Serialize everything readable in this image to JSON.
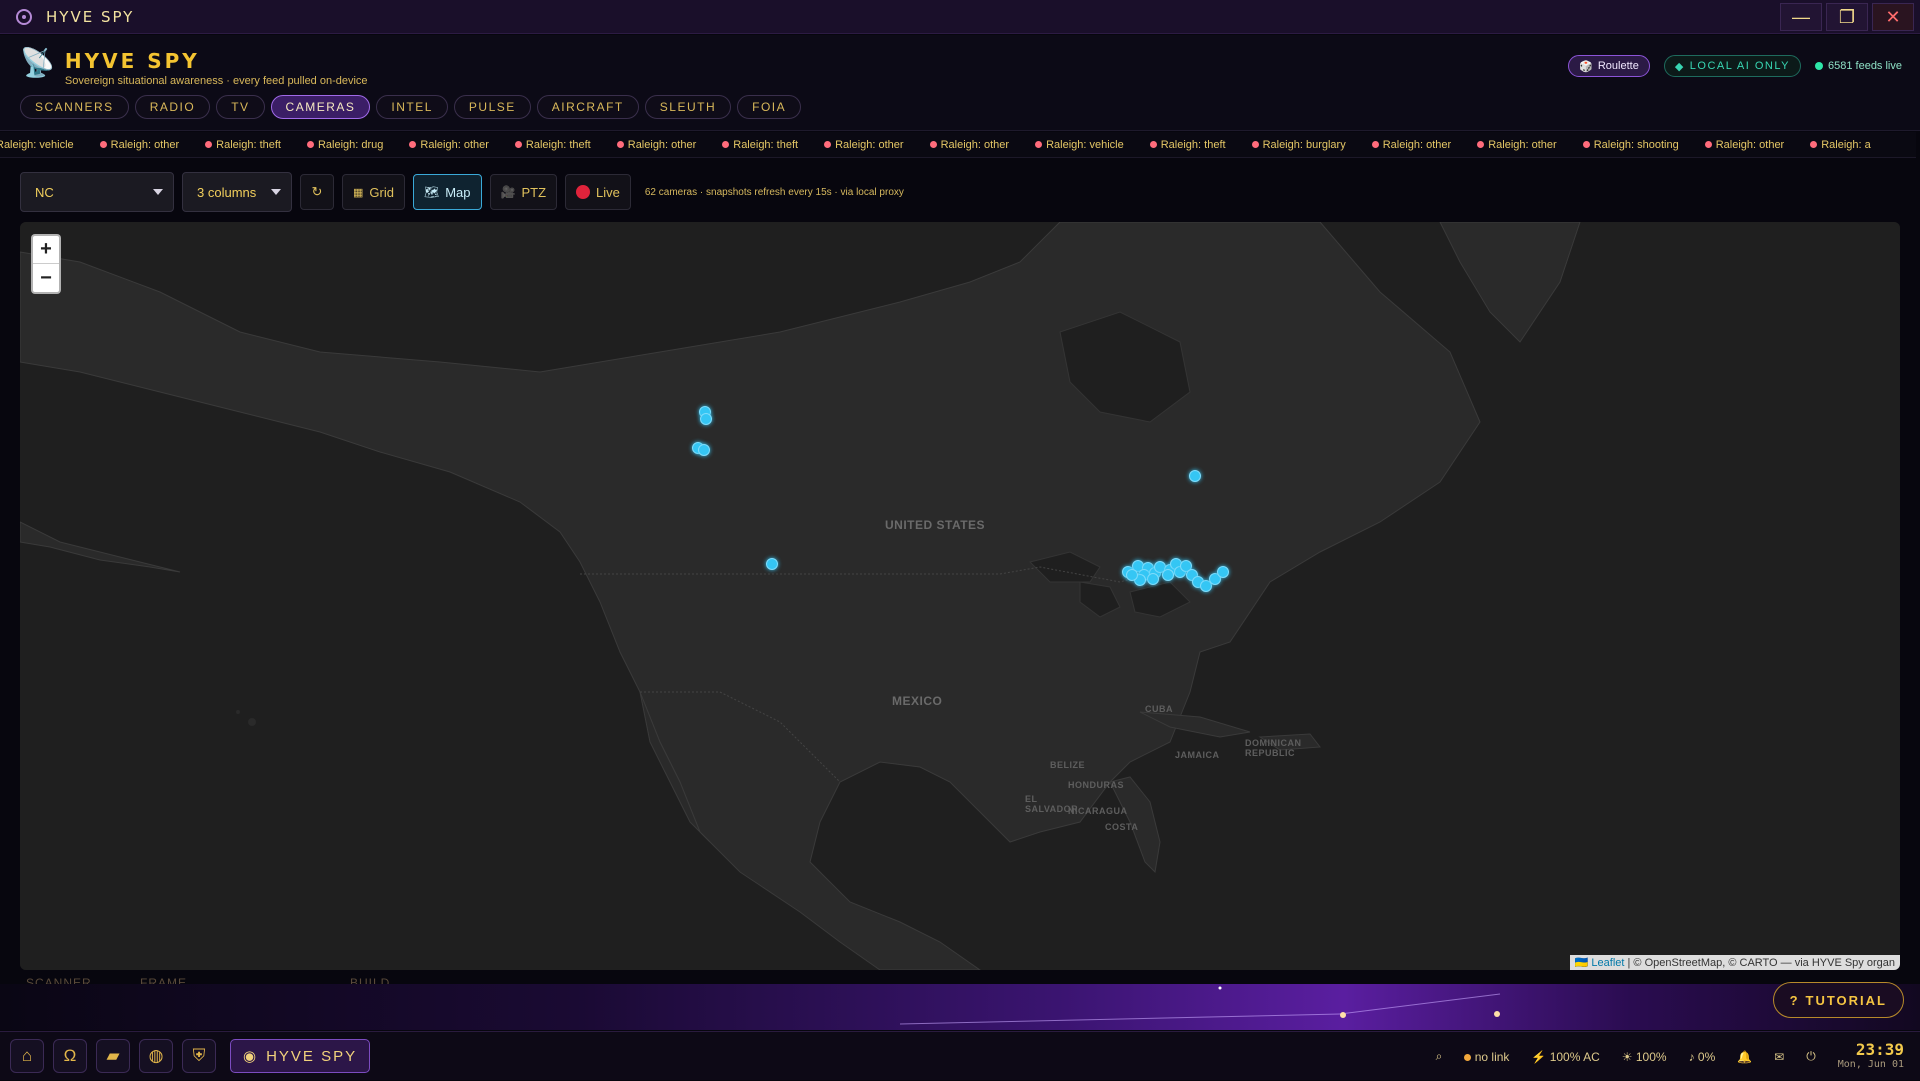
{
  "window": {
    "title": "HYVE SPY",
    "minimize": "—",
    "maximize": "❐",
    "close": "✕"
  },
  "app": {
    "name": "HYVE SPY",
    "tagline": "Sovereign situational awareness · every feed pulled on-device",
    "roulette": "Roulette",
    "local_ai": "LOCAL AI ONLY",
    "feeds_live": "6581 feeds live"
  },
  "tabs": [
    {
      "label": "SCANNERS"
    },
    {
      "label": "RADIO"
    },
    {
      "label": "TV"
    },
    {
      "label": "CAMERAS",
      "active": true
    },
    {
      "label": "INTEL"
    },
    {
      "label": "PULSE"
    },
    {
      "label": "AIRCRAFT"
    },
    {
      "label": "SLEUTH"
    },
    {
      "label": "FOIA"
    }
  ],
  "ticker": [
    "Raleigh: vehicle",
    "Raleigh: other",
    "Raleigh: theft",
    "Raleigh: drug",
    "Raleigh: other",
    "Raleigh: theft",
    "Raleigh: other",
    "Raleigh: theft",
    "Raleigh: other",
    "Raleigh: other",
    "Raleigh: vehicle",
    "Raleigh: theft",
    "Raleigh: burglary",
    "Raleigh: other",
    "Raleigh: other",
    "Raleigh: shooting",
    "Raleigh: other",
    "Raleigh: a"
  ],
  "toolbar": {
    "region": "NC",
    "columns": "3 columns",
    "grid": "Grid",
    "map": "Map",
    "ptz": "PTZ",
    "live": "Live",
    "info": "62 cameras · snapshots refresh every 15s · via local proxy"
  },
  "map": {
    "zoom_in": "+",
    "zoom_out": "−",
    "attribution_link": "Leaflet",
    "attribution_rest": "| © OpenStreetMap, © CARTO — via HYVE Spy organ",
    "labels": {
      "us": "UNITED STATES",
      "mexico": "MEXICO",
      "cuba": "CUBA",
      "dominican": "DOMINICAN REPUBLIC",
      "jamaica": "JAMAICA",
      "belize": "BELIZE",
      "honduras": "HONDURAS",
      "salvador": "EL SALVADOR",
      "nicaragua": "NICARAGUA",
      "costa": "COSTA"
    },
    "camera_color": "#35c6f4"
  },
  "ghost_labels": {
    "a": "SCANNER",
    "b": "FRAME",
    "c": "BUILD"
  },
  "tutorial": "TUTORIAL",
  "taskbar": {
    "app": "HYVE SPY",
    "icons": [
      "home-icon",
      "omega-icon",
      "folder-icon",
      "globe-icon",
      "shield-icon"
    ]
  },
  "tray": {
    "link": "no link",
    "power": "100% AC",
    "brightness": "100%",
    "volume": "0%",
    "time": "23:39",
    "date": "Mon, Jun 01"
  }
}
